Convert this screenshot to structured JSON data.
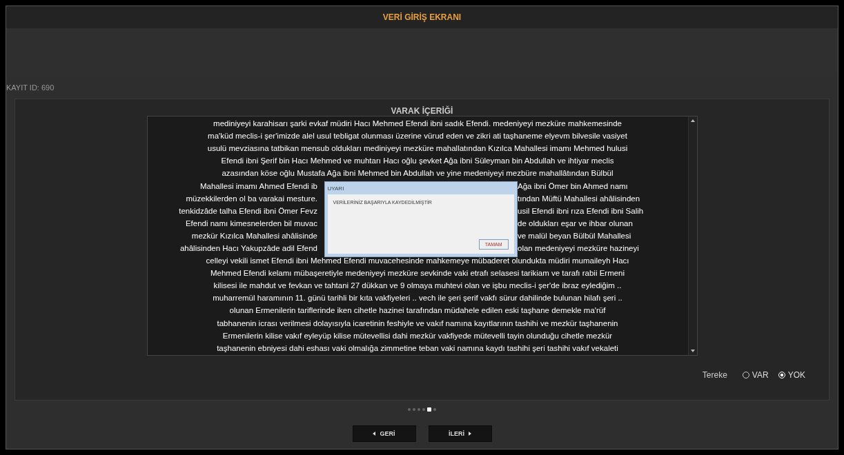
{
  "header": {
    "title": "VERİ GİRİŞ EKRANI"
  },
  "record_id": "KAYIT ID: 690",
  "panel": {
    "title": "VARAK İÇERİĞİ",
    "lines": [
      {
        "text": "mediniyeyi karahisarı şarki evkaf müdiri Hacı Mehmed Efendi ibni sadık Efendi. medeniyeyi mezküre mahkemesinde"
      },
      {
        "text": "ma'küd meclis-i şer'imizde alel usul tebligat olunması üzerine vürud eden ve zikri ati taşhaneme elyevm bilvesile vasiyet"
      },
      {
        "text": "usulü mevziasına tatbikan mensub oldukları mediniyeyi mezküre mahallatından Kızılca Mahallesi imamı Mehmed hulusi"
      },
      {
        "text": "Efendi ibni Şerif bin Hacı Mehmed ve muhtarı Hacı oğlu şevket Ağa ibni Süleyman bin Abdullah ve ihtiyar meclis"
      },
      {
        "text": "azasından köse oğlu Mustafa Ağa ibni Mehmed bin Abdullah ve yine medeniyeyi mezbüre mahallâtından Bülbül"
      },
      {
        "left": "Mahallesi imamı Ahmed Efendi ib",
        "right": "Ağa ibni Ömer bin Ahmed namı"
      },
      {
        "left": "müzekkilerden ol ba varakai mesture.",
        "right": "tından Müftü Mahallesi ahâlisinden"
      },
      {
        "left": "tenkidzâde talha Efendi ibni Ömer Fevz",
        "right": "usil Efendi ibni rıza Efendi ibni Salih"
      },
      {
        "left": "Efendi namı kimesnelerden bil muvac",
        "right": "de oldukları eşar ve ihbar olunan"
      },
      {
        "left": "mezkür Kızılca Mahallesi ahâlisinde",
        "right": "ve malül beyan Bülbül Mahallesi"
      },
      {
        "left": "ahâlisinden Hacı Yakupzâde adil Efend",
        "right": "olan medeniyeyi mezküre hazineyi"
      },
      {
        "text": "celleyi vekili ismet Efendi ibni Mehmed Efendi muvacehesinde mahkemeye mübaderet olundukta müdiri mumaileyh Hacı"
      },
      {
        "text": "Mehmed Efendi kelamı mübaşeretiyle medeniyeyi mezküre sevkinde vaki etrafı selasesi tarikiam ve tarafı rabii Ermeni"
      },
      {
        "text": "kilisesi ile mahdut ve fevkan ve tahtani  27 dükkan ve 9 olmaya muhtevi olan ve işbu meclis-i şer'de ibraz eylediğim .."
      },
      {
        "text": "muharremül haramının 11. günü tarihli bir  kıta vakfiyeleri .. vech ile şeri şerif vakfı sürur dahilinde bulunan hilafı şeri .."
      },
      {
        "text": "olunan  Ermenilerin tariflerinde iken  cihetle hazinei tarafından  müdahele edilen eski taşhane demekle ma'rüf"
      },
      {
        "text": "tabhanenin icrası  verilmesi dolayısıyla icaretinin feshiyle ve vakıf namına kayıtlarının  tashihi  ve mezkür taşhanenin"
      },
      {
        "text": "Ermenilerin kilise  vakıf eyleyüp kilise mütevellisi dahi mezkür vakfiyede mütevelli tayin olunduğu cihetle mezkür"
      },
      {
        "text": "taşhanenin ebniyesi dahi eshası  vaki olmalığa zimmetine teban vaki namına kaydı tashihi  şeri tashihi vakıf vekaleti"
      }
    ],
    "tereke": {
      "label": "Tereke",
      "options": [
        {
          "label": "VAR",
          "selected": false
        },
        {
          "label": "YOK",
          "selected": true
        }
      ]
    }
  },
  "pager": [
    {
      "selected": false
    },
    {
      "selected": false
    },
    {
      "selected": false
    },
    {
      "selected": false
    },
    {
      "selected": true
    },
    {
      "selected": false
    }
  ],
  "buttons": [
    {
      "kind": "back",
      "label": "GERİ"
    },
    {
      "kind": "next",
      "label": "İLERİ"
    }
  ],
  "dialog": {
    "title": "UYARI",
    "message": "VERİLERİNİZ BAŞARIYLA KAYDEDİLMİŞTİR",
    "button": "TAMAM"
  }
}
